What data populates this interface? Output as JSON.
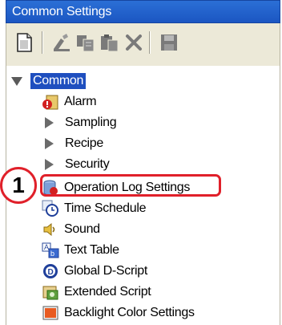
{
  "window": {
    "title": "Common Settings"
  },
  "toolbar": {
    "buttons": [
      "new-icon",
      "edit-icon",
      "copy-icon",
      "paste-icon",
      "delete-icon",
      "save-icon"
    ]
  },
  "tree": {
    "root": {
      "label": "Common",
      "expanded": true
    },
    "items": [
      {
        "label": "Alarm",
        "icon": "alarm-icon"
      },
      {
        "label": "Sampling",
        "icon": "collapsed-arrow"
      },
      {
        "label": "Recipe",
        "icon": "collapsed-arrow"
      },
      {
        "label": "Security",
        "icon": "collapsed-arrow"
      },
      {
        "label": "Operation Log Settings",
        "icon": "operation-log-icon"
      },
      {
        "label": "Time Schedule",
        "icon": "time-schedule-icon"
      },
      {
        "label": "Sound",
        "icon": "sound-icon"
      },
      {
        "label": "Text Table",
        "icon": "text-table-icon"
      },
      {
        "label": "Global D-Script",
        "icon": "d-script-icon"
      },
      {
        "label": "Extended Script",
        "icon": "extended-script-icon"
      },
      {
        "label": "Backlight Color Settings",
        "icon": "backlight-icon"
      }
    ]
  },
  "annotation": {
    "callout_number": "1",
    "color": "#e0202a"
  }
}
